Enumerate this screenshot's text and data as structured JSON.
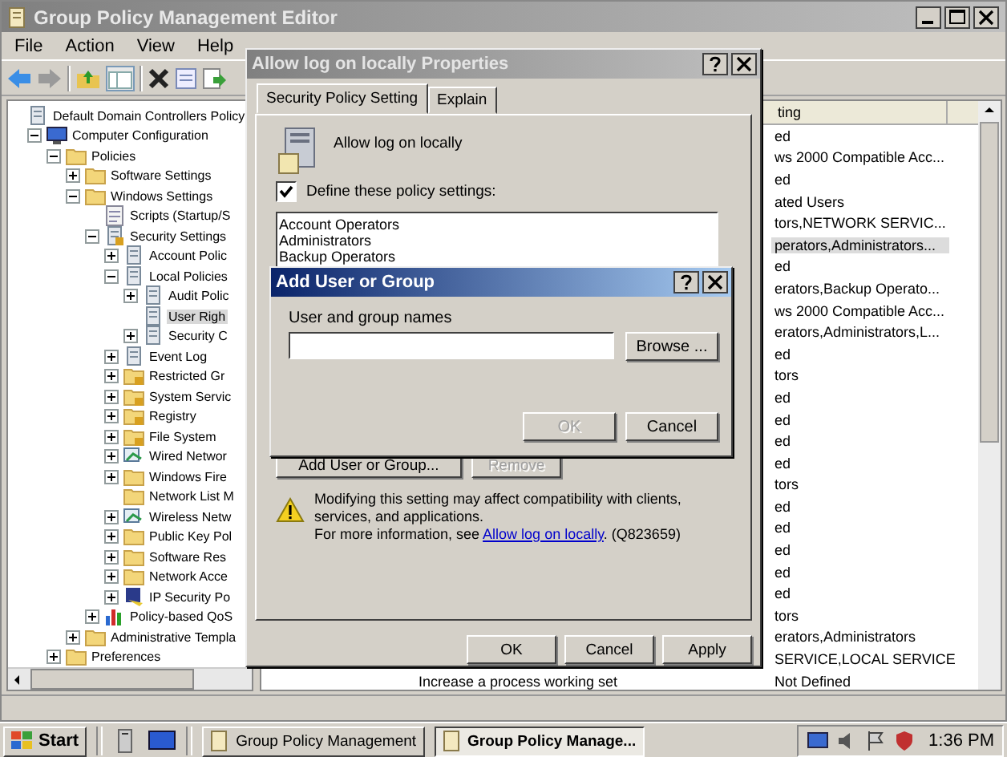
{
  "window": {
    "title": "Group Policy Management Editor"
  },
  "menu": [
    "File",
    "Action",
    "View",
    "Help"
  ],
  "tree": {
    "label": "Default Domain Controllers Policy",
    "kind": "policy",
    "selected": false,
    "children": [
      {
        "label": "Computer Configuration",
        "kind": "computer",
        "expanded": true,
        "selected": false,
        "children": [
          {
            "label": "Policies",
            "kind": "folder",
            "expanded": true,
            "selected": false,
            "children": [
              {
                "label": "Software Settings",
                "kind": "folder",
                "expanded": false,
                "selected": false
              },
              {
                "label": "Windows Settings",
                "kind": "folder",
                "expanded": true,
                "selected": false,
                "children": [
                  {
                    "label": "Scripts (Startup/S",
                    "kind": "script",
                    "selected": false
                  },
                  {
                    "label": "Security Settings",
                    "kind": "locked-policy",
                    "expanded": true,
                    "selected": false,
                    "children": [
                      {
                        "label": "Account Polic",
                        "kind": "policy",
                        "expanded": false,
                        "selected": false
                      },
                      {
                        "label": "Local Policies",
                        "kind": "policy",
                        "expanded": true,
                        "selected": false,
                        "children": [
                          {
                            "label": "Audit Polic",
                            "kind": "policy",
                            "expanded": false,
                            "selected": false
                          },
                          {
                            "label": "User Righ",
                            "kind": "policy",
                            "selected": true
                          },
                          {
                            "label": "Security C",
                            "kind": "policy",
                            "expanded": false,
                            "selected": false
                          }
                        ]
                      },
                      {
                        "label": "Event Log",
                        "kind": "policy",
                        "expanded": false,
                        "selected": false
                      },
                      {
                        "label": "Restricted Gr",
                        "kind": "locked-folder",
                        "expanded": false,
                        "selected": false
                      },
                      {
                        "label": "System Servic",
                        "kind": "locked-folder",
                        "expanded": false,
                        "selected": false
                      },
                      {
                        "label": "Registry",
                        "kind": "locked-folder",
                        "expanded": false,
                        "selected": false
                      },
                      {
                        "label": "File System",
                        "kind": "locked-folder",
                        "expanded": false,
                        "selected": false
                      },
                      {
                        "label": "Wired Networ",
                        "kind": "network",
                        "expanded": false,
                        "selected": false
                      },
                      {
                        "label": "Windows Fire",
                        "kind": "folder",
                        "expanded": false,
                        "selected": false
                      },
                      {
                        "label": "Network List M",
                        "kind": "folder",
                        "selected": false
                      },
                      {
                        "label": "Wireless Netw",
                        "kind": "network",
                        "expanded": false,
                        "selected": false
                      },
                      {
                        "label": "Public Key Pol",
                        "kind": "folder",
                        "expanded": false,
                        "selected": false
                      },
                      {
                        "label": "Software Res",
                        "kind": "folder",
                        "expanded": false,
                        "selected": false
                      },
                      {
                        "label": "Network Acce",
                        "kind": "folder",
                        "expanded": false,
                        "selected": false
                      },
                      {
                        "label": "IP Security Po",
                        "kind": "shield",
                        "expanded": false,
                        "selected": false
                      }
                    ]
                  },
                  {
                    "label": "Policy-based QoS",
                    "kind": "chart",
                    "expanded": false,
                    "selected": false
                  }
                ]
              },
              {
                "label": "Administrative Templa",
                "kind": "folder",
                "expanded": false,
                "selected": false
              }
            ]
          },
          {
            "label": "Preferences",
            "kind": "folder",
            "expanded": false,
            "selected": false
          }
        ]
      }
    ]
  },
  "list": {
    "header": "ting",
    "rows": [
      {
        "setting": "ed",
        "selected": false
      },
      {
        "setting": "ws 2000 Compatible Acc...",
        "selected": false
      },
      {
        "setting": "ed",
        "selected": false
      },
      {
        "setting": "ated Users",
        "selected": false
      },
      {
        "setting": "tors,NETWORK SERVIC...",
        "selected": false
      },
      {
        "setting": "perators,Administrators...",
        "selected": true
      },
      {
        "setting": "ed",
        "selected": false
      },
      {
        "setting": "erators,Backup Operato...",
        "selected": false
      },
      {
        "setting": "ws 2000 Compatible Acc...",
        "selected": false
      },
      {
        "setting": "erators,Administrators,L...",
        "selected": false
      },
      {
        "setting": "ed",
        "selected": false
      },
      {
        "setting": "tors",
        "selected": false
      },
      {
        "setting": "ed",
        "selected": false
      },
      {
        "setting": "ed",
        "selected": false
      },
      {
        "setting": "ed",
        "selected": false
      },
      {
        "setting": "ed",
        "selected": false
      },
      {
        "setting": "tors",
        "selected": false
      },
      {
        "setting": "ed",
        "selected": false
      },
      {
        "setting": "ed",
        "selected": false
      },
      {
        "setting": "ed",
        "selected": false
      },
      {
        "setting": "ed",
        "selected": false
      },
      {
        "setting": "ed",
        "selected": false
      },
      {
        "setting": "tors",
        "selected": false
      },
      {
        "setting": "erators,Administrators",
        "selected": false
      },
      {
        "setting": "SERVICE,LOCAL SERVICE",
        "selected": false
      },
      {
        "policy": "Increase a process working set",
        "setting": "Not Defined",
        "selected": false
      }
    ]
  },
  "properties_dialog": {
    "title": "Allow log on locally Properties",
    "tabs": [
      {
        "label": "Security Policy Setting",
        "selected": true
      },
      {
        "label": "Explain",
        "selected": false
      }
    ],
    "policy_name": "Allow log on locally",
    "define": {
      "label": "Define these policy settings:",
      "checked": true
    },
    "members": [
      "Account Operators",
      "Administrators",
      "Backup Operators"
    ],
    "add_button": {
      "label": "Add User or Group...",
      "disabled": false
    },
    "remove_button": {
      "label": "Remove",
      "disabled": true
    },
    "warning": {
      "text": "Modifying this setting may affect compatibility with clients, services, and applications.",
      "more_prefix": "For more information, see ",
      "link": "Allow log on locally",
      "more_suffix": ". (Q823659)"
    },
    "buttons": [
      {
        "label": "OK",
        "disabled": false
      },
      {
        "label": "Cancel",
        "disabled": false
      },
      {
        "label": "Apply",
        "disabled": false
      }
    ]
  },
  "add_dialog": {
    "title": "Add User or Group",
    "field_label": "User and group names",
    "browse": "Browse ...",
    "buttons": [
      {
        "label": "OK",
        "disabled": true
      },
      {
        "label": "Cancel",
        "disabled": false
      }
    ]
  },
  "taskbar": {
    "start": "Start",
    "tasks": [
      {
        "label": "Group Policy Management",
        "selected": false
      },
      {
        "label": "Group Policy Manage...",
        "selected": true
      }
    ],
    "clock": "1:36 PM"
  }
}
